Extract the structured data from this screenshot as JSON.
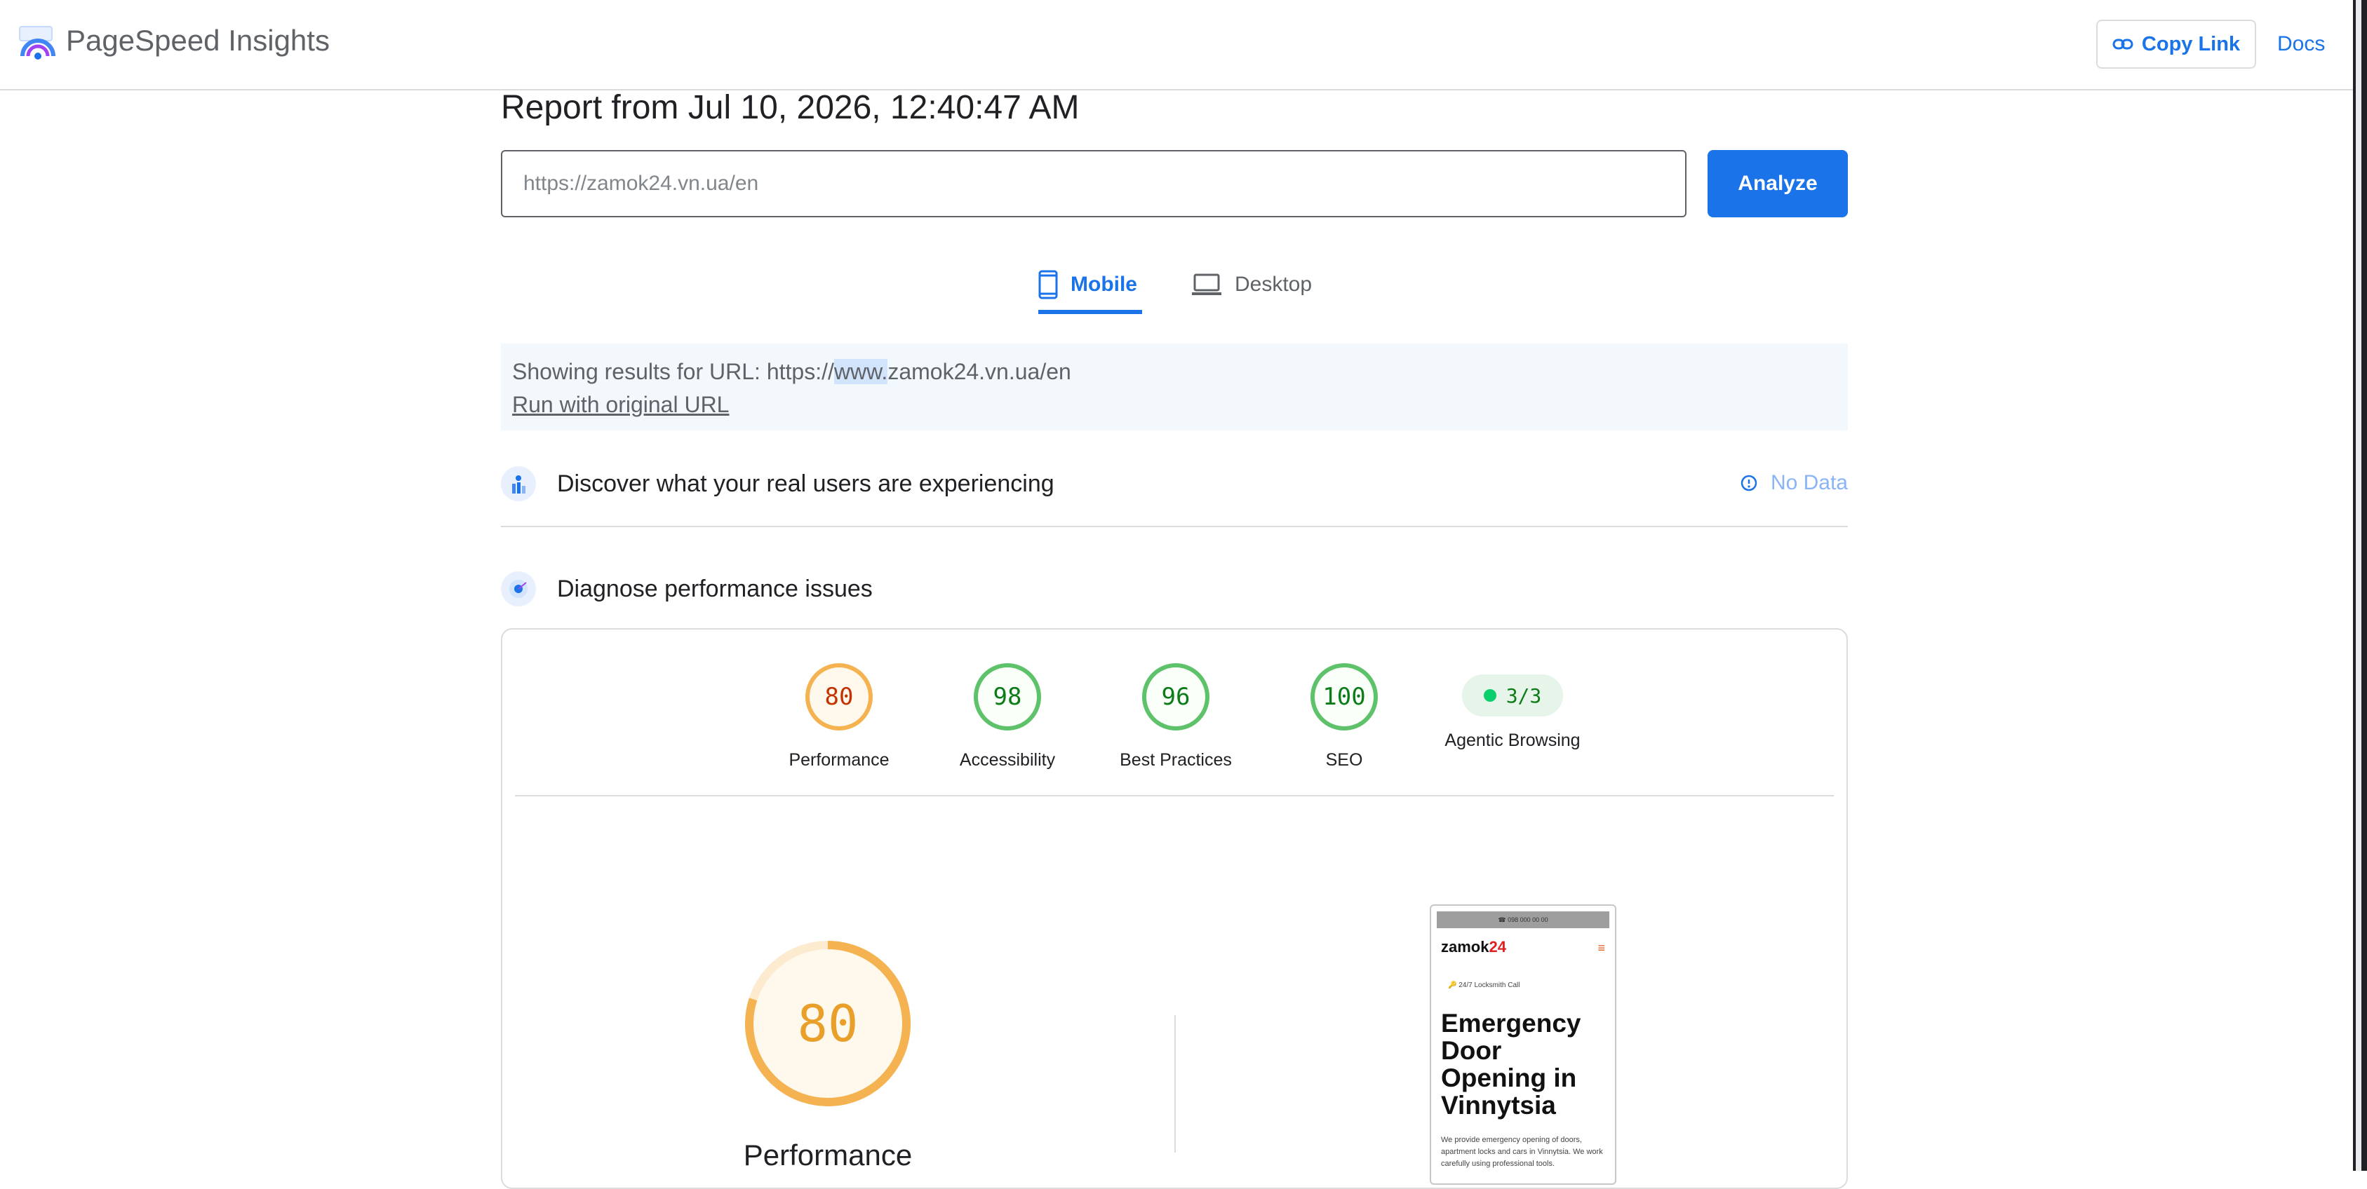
{
  "header": {
    "brand": "PageSpeed Insights",
    "copy_link_label": "Copy Link",
    "docs_label": "Docs",
    "logo_icon": "pagespeed-logo-icon",
    "link_icon": "link-icon"
  },
  "report": {
    "title": "Report from Jul 10, 2026, 12:40:47 AM"
  },
  "search": {
    "value": "https://zamok24.vn.ua/en",
    "analyze_label": "Analyze"
  },
  "tabs": [
    {
      "label": "Mobile",
      "icon": "smartphone-icon",
      "active": true
    },
    {
      "label": "Desktop",
      "icon": "laptop-icon",
      "active": false
    }
  ],
  "notice": {
    "prefix": "Showing results for URL: https://",
    "highlight": "www.",
    "suffix": "zamok24.vn.ua/en",
    "link": "Run with original URL"
  },
  "sections": {
    "crux": {
      "title": "Discover what your real users are experiencing",
      "status": "No Data",
      "icon": "users-chart-icon",
      "status_icon": "info-icon"
    },
    "diagnose": {
      "title": "Diagnose performance issues",
      "icon": "lighthouse-icon"
    }
  },
  "scores": [
    {
      "label": "Performance",
      "value": "80",
      "color": "#f4b350"
    },
    {
      "label": "Accessibility",
      "value": "98",
      "color": "#5ec26a"
    },
    {
      "label": "Best Practices",
      "value": "96",
      "color": "#5ec26a"
    },
    {
      "label": "SEO",
      "value": "100",
      "color": "#5ec26a"
    },
    {
      "label": "Agentic Browsing",
      "value": "3/3",
      "color": "#0cce6b"
    }
  ],
  "main_score": {
    "value": "80",
    "label": "Performance",
    "fraction": 0.8,
    "color": "#f4b350"
  },
  "preview": {
    "topbar": "☎ 098 000 00 00",
    "logo_main": "zamok",
    "logo_num": "24",
    "tag": "🔑 24/7 Locksmith Call",
    "headline": "Emergency Door Opening in Vinnytsia",
    "body": "We provide emergency opening of doors, apartment locks and cars in Vinnytsia. We work carefully using professional tools."
  },
  "colors": {
    "accent": "#1a73e8",
    "average": "#f4b350",
    "pass": "#5ec26a"
  }
}
